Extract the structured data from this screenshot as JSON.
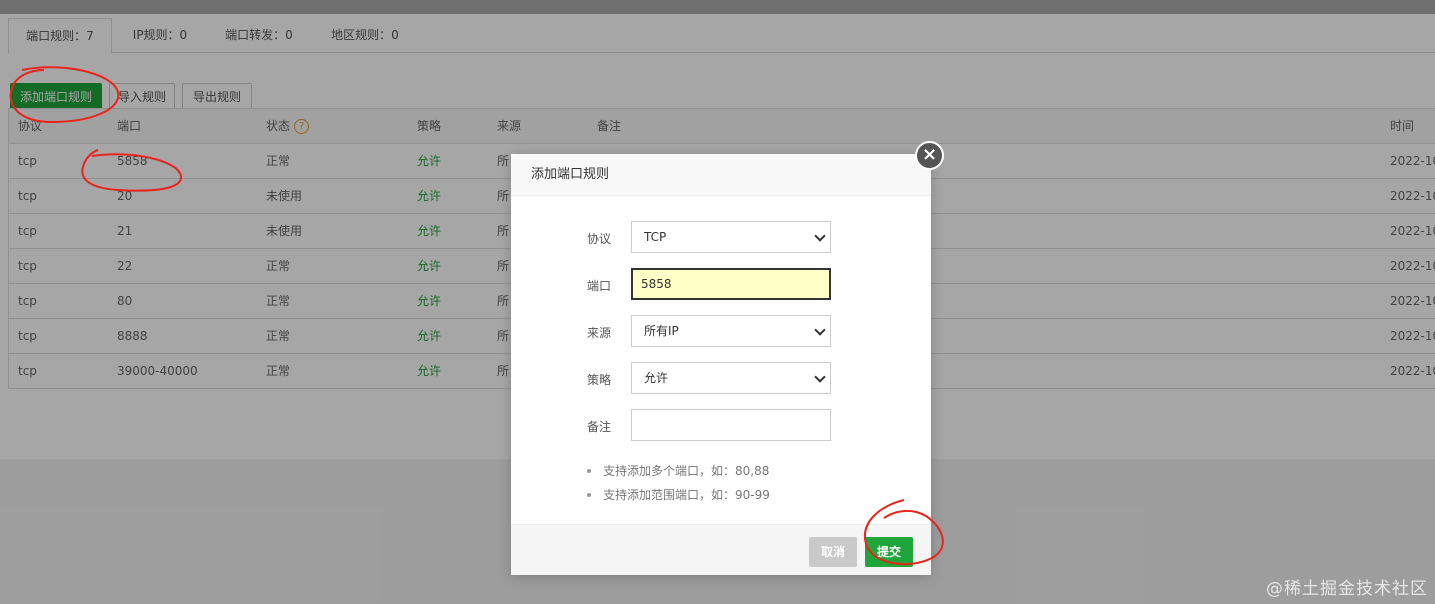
{
  "tabs": [
    {
      "label": "端口规则：7"
    },
    {
      "label": "IP规则：0"
    },
    {
      "label": "端口转发：0"
    },
    {
      "label": "地区规则：0"
    }
  ],
  "toolbar": {
    "add_label": "添加端口规则",
    "import_label": "导入规则",
    "export_label": "导出规则"
  },
  "table": {
    "headers": {
      "protocol": "协议",
      "port": "端口",
      "status": "状态",
      "policy": "策略",
      "source": "来源",
      "note": "备注",
      "time": "时间"
    },
    "help_glyph": "?",
    "rows": [
      {
        "protocol": "tcp",
        "port": "5858",
        "status": "正常",
        "policy": "允许",
        "source": "所",
        "time": "2022-10"
      },
      {
        "protocol": "tcp",
        "port": "20",
        "status": "未使用",
        "policy": "允许",
        "source": "所",
        "time": "2022-10"
      },
      {
        "protocol": "tcp",
        "port": "21",
        "status": "未使用",
        "policy": "允许",
        "source": "所",
        "time": "2022-10"
      },
      {
        "protocol": "tcp",
        "port": "22",
        "status": "正常",
        "policy": "允许",
        "source": "所",
        "time": "2022-10"
      },
      {
        "protocol": "tcp",
        "port": "80",
        "status": "正常",
        "policy": "允许",
        "source": "所",
        "time": "2022-10"
      },
      {
        "protocol": "tcp",
        "port": "8888",
        "status": "正常",
        "policy": "允许",
        "source": "所",
        "time": "2022-10"
      },
      {
        "protocol": "tcp",
        "port": "39000-40000",
        "status": "正常",
        "policy": "允许",
        "source": "所",
        "time": "2022-10"
      }
    ]
  },
  "modal": {
    "title": "添加端口规则",
    "close_glyph": "×",
    "fields": {
      "protocol": {
        "label": "协议",
        "value": "TCP"
      },
      "port": {
        "label": "端口",
        "value": "5858"
      },
      "source": {
        "label": "来源",
        "value": "所有IP"
      },
      "policy": {
        "label": "策略",
        "value": "允许"
      },
      "note": {
        "label": "备注",
        "value": ""
      }
    },
    "tips": [
      "支持添加多个端口，如：80,88",
      "支持添加范围端口，如：90-99"
    ],
    "cancel_label": "取消",
    "submit_label": "提交"
  },
  "watermark": "@稀土掘金技术社区",
  "colors": {
    "accent_green": "#20a53a",
    "annotation_red": "#e8241c",
    "help_orange": "#e39b25"
  }
}
